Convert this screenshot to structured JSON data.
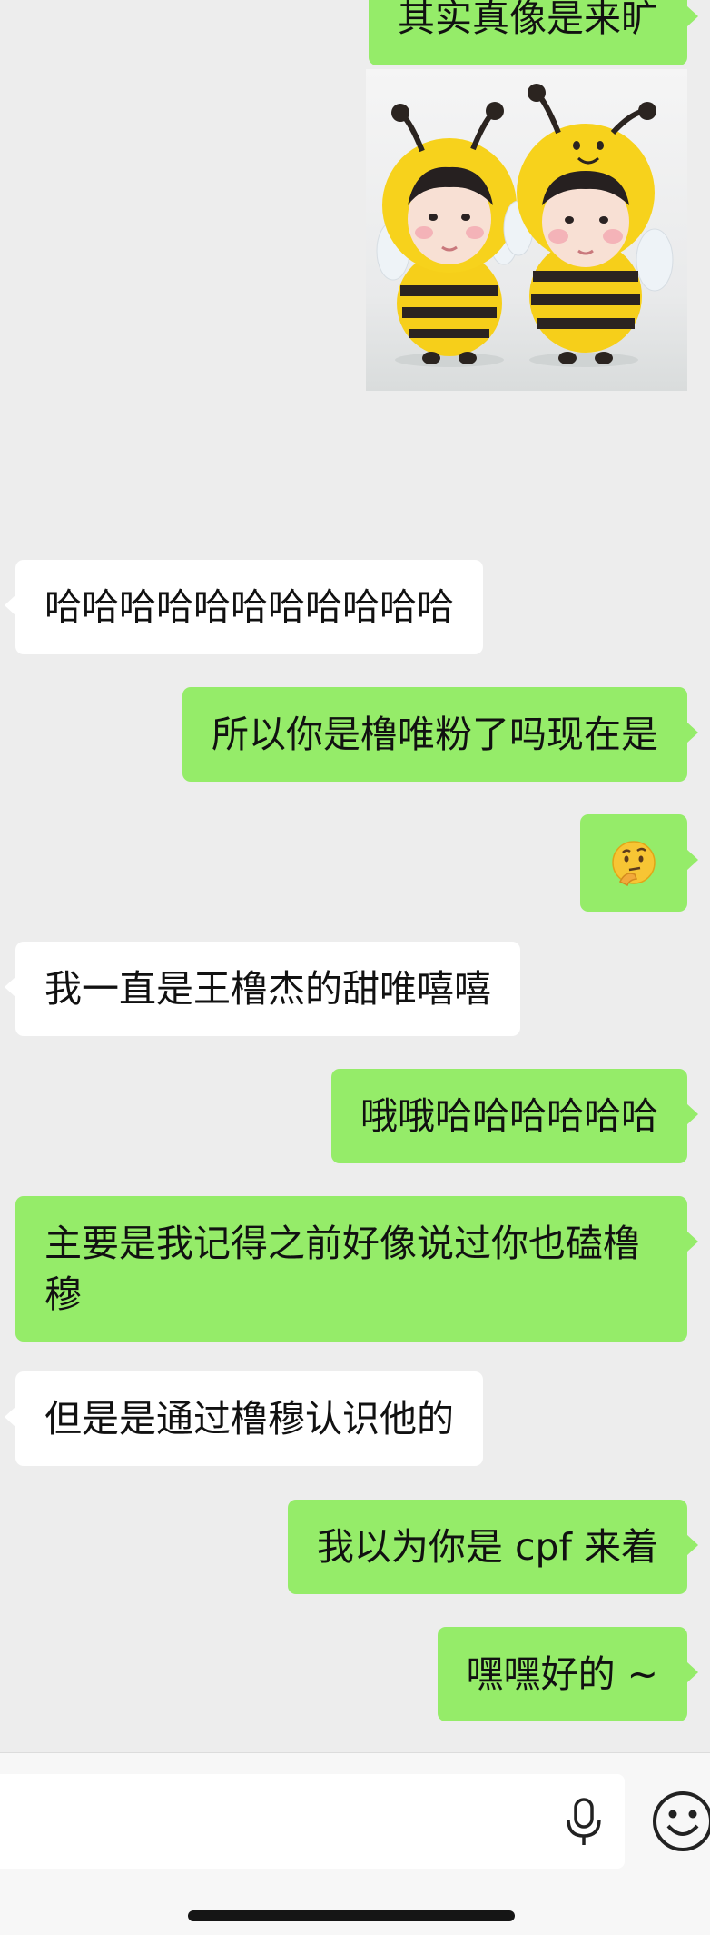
{
  "messages": [
    {
      "side": "out",
      "text": "其实真像是来旷"
    },
    {
      "side": "out",
      "type": "image",
      "icon": "bee-costume-kids-sticker"
    },
    {
      "side": "in",
      "text": "哈哈哈哈哈哈哈哈哈哈哈"
    },
    {
      "side": "out",
      "text": "所以你是橹唯粉了吗现在是"
    },
    {
      "side": "out",
      "type": "emoji",
      "icon": "thinking-face-emoji"
    },
    {
      "side": "in",
      "text": "我一直是王橹杰的甜唯嘻嘻"
    },
    {
      "side": "out",
      "text": "哦哦哈哈哈哈哈哈"
    },
    {
      "side": "out",
      "text": "主要是我记得之前好像说过你也磕橹穆"
    },
    {
      "side": "in",
      "text": "但是是通过橹穆认识他的"
    },
    {
      "side": "out",
      "text": "我以为你是 cpf 来着"
    },
    {
      "side": "out",
      "text": "嘿嘿好的 ~"
    }
  ],
  "input_bar": {
    "input_value": "",
    "voice_icon": "microphone-icon",
    "emoji_icon": "smiley-face-icon"
  },
  "colors": {
    "background": "#ededed",
    "outgoing_bubble": "#95ec69",
    "incoming_bubble": "#ffffff"
  }
}
